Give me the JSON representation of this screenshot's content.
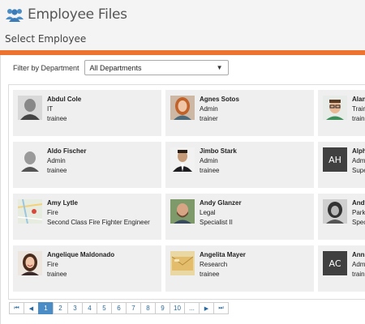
{
  "header": {
    "title": "Employee Files",
    "subtitle": "Select Employee"
  },
  "filter": {
    "label": "Filter by Department",
    "selected": "All Departments"
  },
  "colors": {
    "accent": "#ec7330",
    "pager_active": "#4a8cc6",
    "card_bg": "#efefef"
  },
  "employees": [
    {
      "name": "Abdul Cole",
      "department": "IT",
      "title": "trainee",
      "avatar": "photo-man-bw"
    },
    {
      "name": "Agnes Sotos",
      "department": "Admin",
      "title": "trainer",
      "avatar": "photo-woman-redhair"
    },
    {
      "name": "Alan M",
      "department": "Trainin",
      "title": "traine",
      "avatar": "photo-man-glasses"
    },
    {
      "name": "Aldo Fischer",
      "department": "Admin",
      "title": "trainee",
      "avatar": "photo-man-old-bw"
    },
    {
      "name": "Jimbo Stark",
      "department": "Admin",
      "title": "trainee",
      "avatar": "photo-man-suit"
    },
    {
      "name": "Alphon",
      "department": "Admin",
      "title": "Super",
      "initials": "AH"
    },
    {
      "name": "Amy Lytle",
      "department": "Fire",
      "title": "Second Class Fire Fighter Engineer",
      "avatar": "map-thumbnail"
    },
    {
      "name": "Andy Glanzer",
      "department": "Legal",
      "title": "Specialist II",
      "avatar": "photo-man-beard"
    },
    {
      "name": "Andy G",
      "department": "Parks",
      "title": "Specia",
      "avatar": "photo-woman-bw"
    },
    {
      "name": "Angelique Maldonado",
      "department": "Fire",
      "title": "trainee",
      "avatar": "photo-woman-smiling"
    },
    {
      "name": "Angelita Mayer",
      "department": "Research",
      "title": "trainee",
      "avatar": "envelope-thumbnail"
    },
    {
      "name": "Ann Cl",
      "department": "Admin",
      "title": "traine",
      "initials": "AC"
    }
  ],
  "pager": {
    "first": "⏮",
    "prev": "◀",
    "pages": [
      "1",
      "2",
      "3",
      "4",
      "5",
      "6",
      "7",
      "8",
      "9",
      "10",
      "..."
    ],
    "active": "1",
    "next": "▶",
    "last": "⏭"
  }
}
